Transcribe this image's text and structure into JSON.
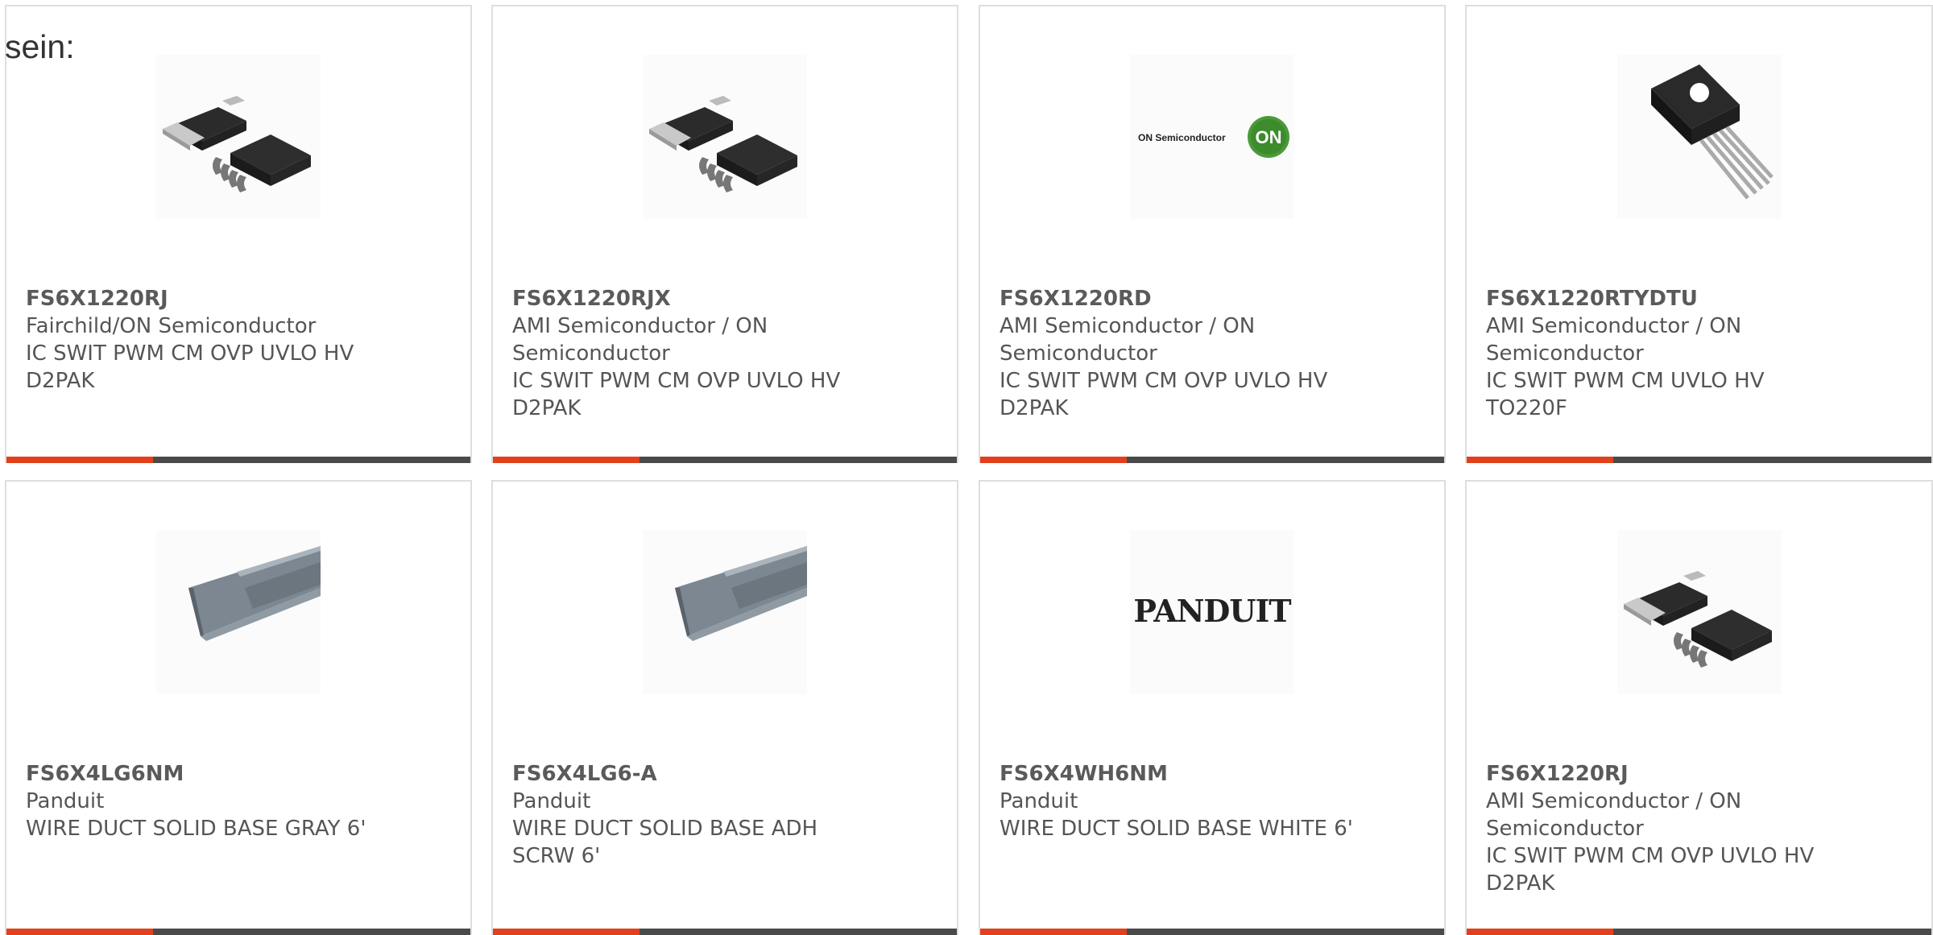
{
  "stray_text": "sein:",
  "colors": {
    "accent": "#e2401c",
    "bar": "#4a4a4a",
    "border": "#dedede",
    "text": "#555555"
  },
  "products": [
    {
      "part_number": "FS6X1220RJ",
      "manufacturer": "Fairchild/ON Semiconductor",
      "description": "IC SWIT PWM CM OVP UVLO HV D2PAK",
      "image": "d2pak-chip-image"
    },
    {
      "part_number": "FS6X1220RJX",
      "manufacturer": "AMI Semiconductor / ON Semiconductor",
      "description": "IC SWIT PWM CM OVP UVLO HV D2PAK",
      "image": "d2pak-chip-image"
    },
    {
      "part_number": "FS6X1220RD",
      "manufacturer": "AMI Semiconductor / ON Semiconductor",
      "description": "IC SWIT PWM CM OVP UVLO HV D2PAK",
      "image": "on-semiconductor-logo",
      "logo_text": "ON Semiconductor",
      "logo_badge": "ON"
    },
    {
      "part_number": "FS6X1220RTYDTU",
      "manufacturer": "AMI Semiconductor / ON Semiconductor",
      "description": "IC SWIT PWM CM UVLO HV TO220F",
      "image": "to220-chip-image"
    },
    {
      "part_number": "FS6X4LG6NM",
      "manufacturer": "Panduit",
      "description": "WIRE DUCT SOLID BASE GRAY 6'",
      "image": "wire-duct-image"
    },
    {
      "part_number": "FS6X4LG6-A",
      "manufacturer": "Panduit",
      "description": "WIRE DUCT SOLID BASE ADH SCRW 6'",
      "image": "wire-duct-image"
    },
    {
      "part_number": "FS6X4WH6NM",
      "manufacturer": "Panduit",
      "description": "WIRE DUCT SOLID BASE WHITE 6'",
      "image": "panduit-logo",
      "logo_text": "PANDUIT"
    },
    {
      "part_number": "FS6X1220RJ",
      "manufacturer": "AMI Semiconductor / ON Semiconductor",
      "description": "IC SWIT PWM CM OVP UVLO HV D2PAK",
      "image": "d2pak-chip-image"
    }
  ]
}
